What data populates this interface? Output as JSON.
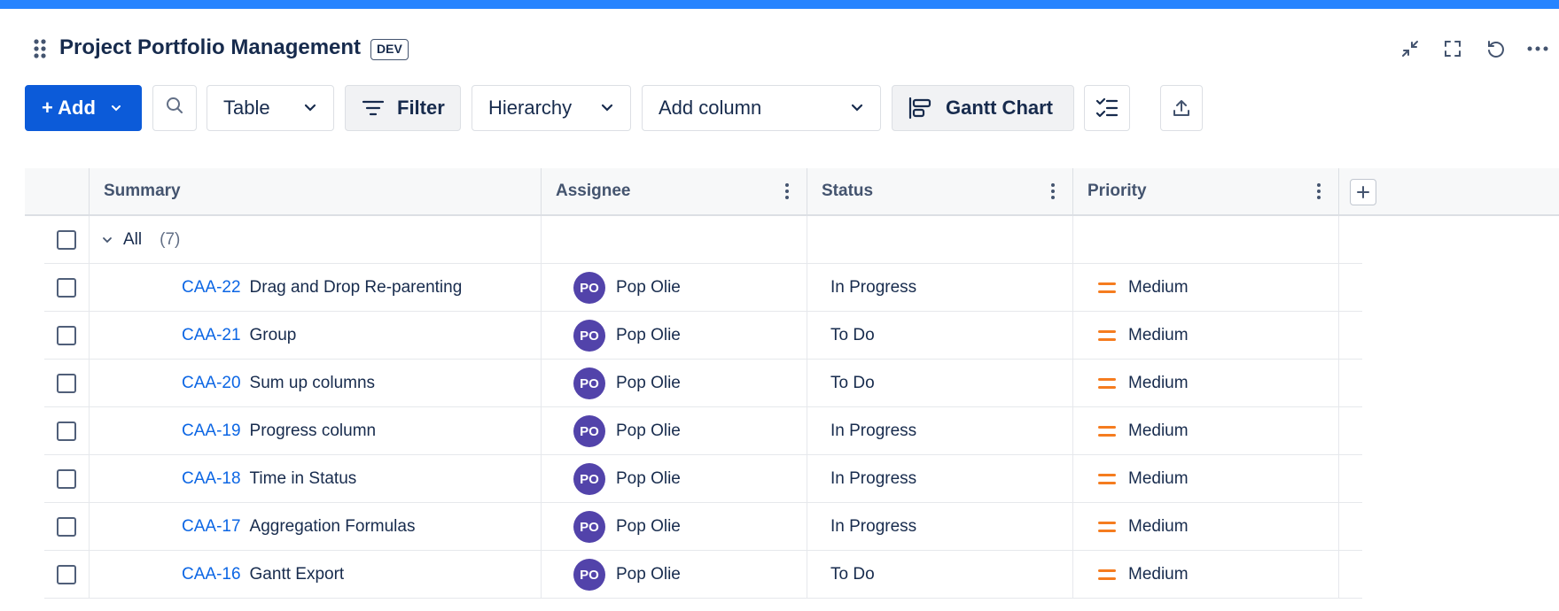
{
  "header": {
    "title": "Project Portfolio Management",
    "env_badge": "DEV",
    "accent_color": "#2684ff"
  },
  "toolbar": {
    "add_label": "+ Add",
    "view_label": "Table",
    "filter_label": "Filter",
    "hierarchy_label": "Hierarchy",
    "add_column_label": "Add column",
    "gantt_label": "Gantt Chart"
  },
  "table": {
    "columns": [
      "Summary",
      "Assignee",
      "Status",
      "Priority"
    ],
    "group": {
      "label": "All",
      "count": "(7)"
    },
    "rows": [
      {
        "key": "CAA-22",
        "summary": "Drag and Drop Re-parenting",
        "avatar": "PO",
        "assignee": "Pop Olie",
        "status": "In Progress",
        "priority": "Medium"
      },
      {
        "key": "CAA-21",
        "summary": "Group",
        "avatar": "PO",
        "assignee": "Pop Olie",
        "status": "To Do",
        "priority": "Medium"
      },
      {
        "key": "CAA-20",
        "summary": "Sum up columns",
        "avatar": "PO",
        "assignee": "Pop Olie",
        "status": "To Do",
        "priority": "Medium"
      },
      {
        "key": "CAA-19",
        "summary": "Progress column",
        "avatar": "PO",
        "assignee": "Pop Olie",
        "status": "In Progress",
        "priority": "Medium"
      },
      {
        "key": "CAA-18",
        "summary": "Time in Status",
        "avatar": "PO",
        "assignee": "Pop Olie",
        "status": "In Progress",
        "priority": "Medium"
      },
      {
        "key": "CAA-17",
        "summary": "Aggregation Formulas",
        "avatar": "PO",
        "assignee": "Pop Olie",
        "status": "In Progress",
        "priority": "Medium"
      },
      {
        "key": "CAA-16",
        "summary": "Gantt Export",
        "avatar": "PO",
        "assignee": "Pop Olie",
        "status": "To Do",
        "priority": "Medium"
      }
    ]
  },
  "colors": {
    "primary": "#0c5bd9",
    "link": "#0c66e4",
    "avatar": "#5243aa",
    "priority_medium": "#f57c1f"
  }
}
